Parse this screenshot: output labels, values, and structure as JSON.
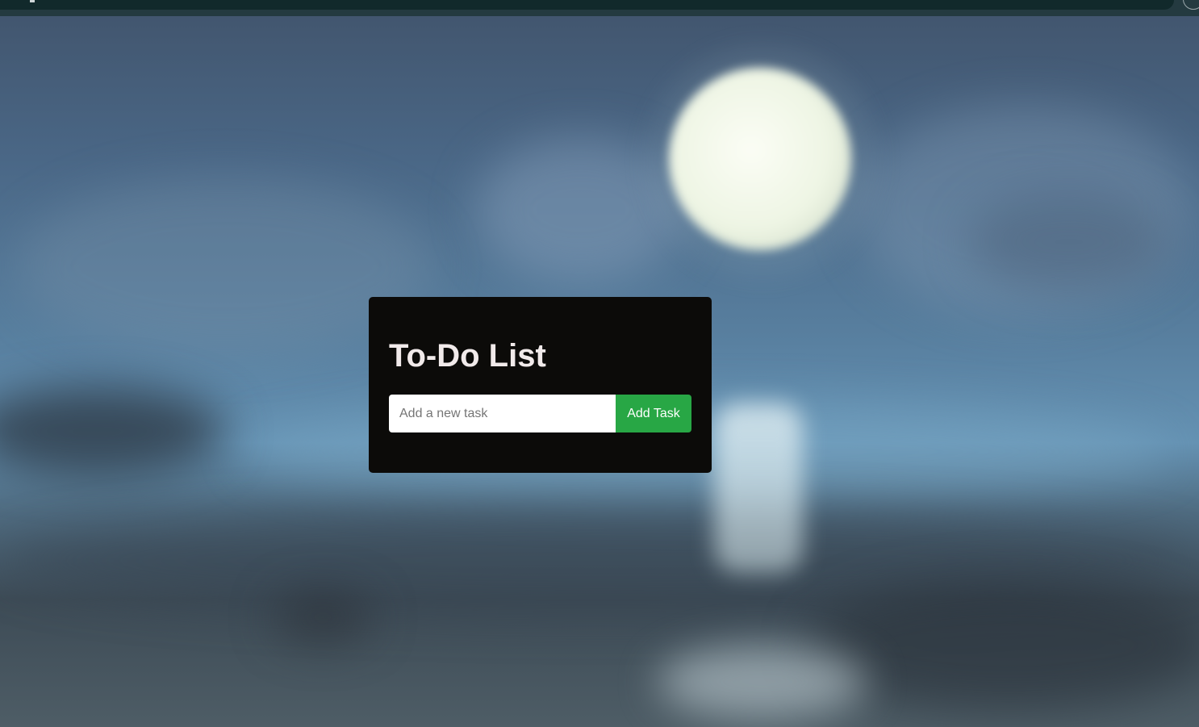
{
  "app": {
    "title": "To-Do List"
  },
  "form": {
    "input_placeholder": "Add a new task",
    "input_value": "",
    "add_button_label": "Add Task"
  },
  "colors": {
    "card_background": "#0c0b09",
    "title_text": "#f1eaea",
    "add_button": "#28a745",
    "add_button_text": "#ffffff",
    "browser_bar": "#11292b"
  },
  "background": {
    "description_icon": "blurred-night-sky-moon-background"
  }
}
